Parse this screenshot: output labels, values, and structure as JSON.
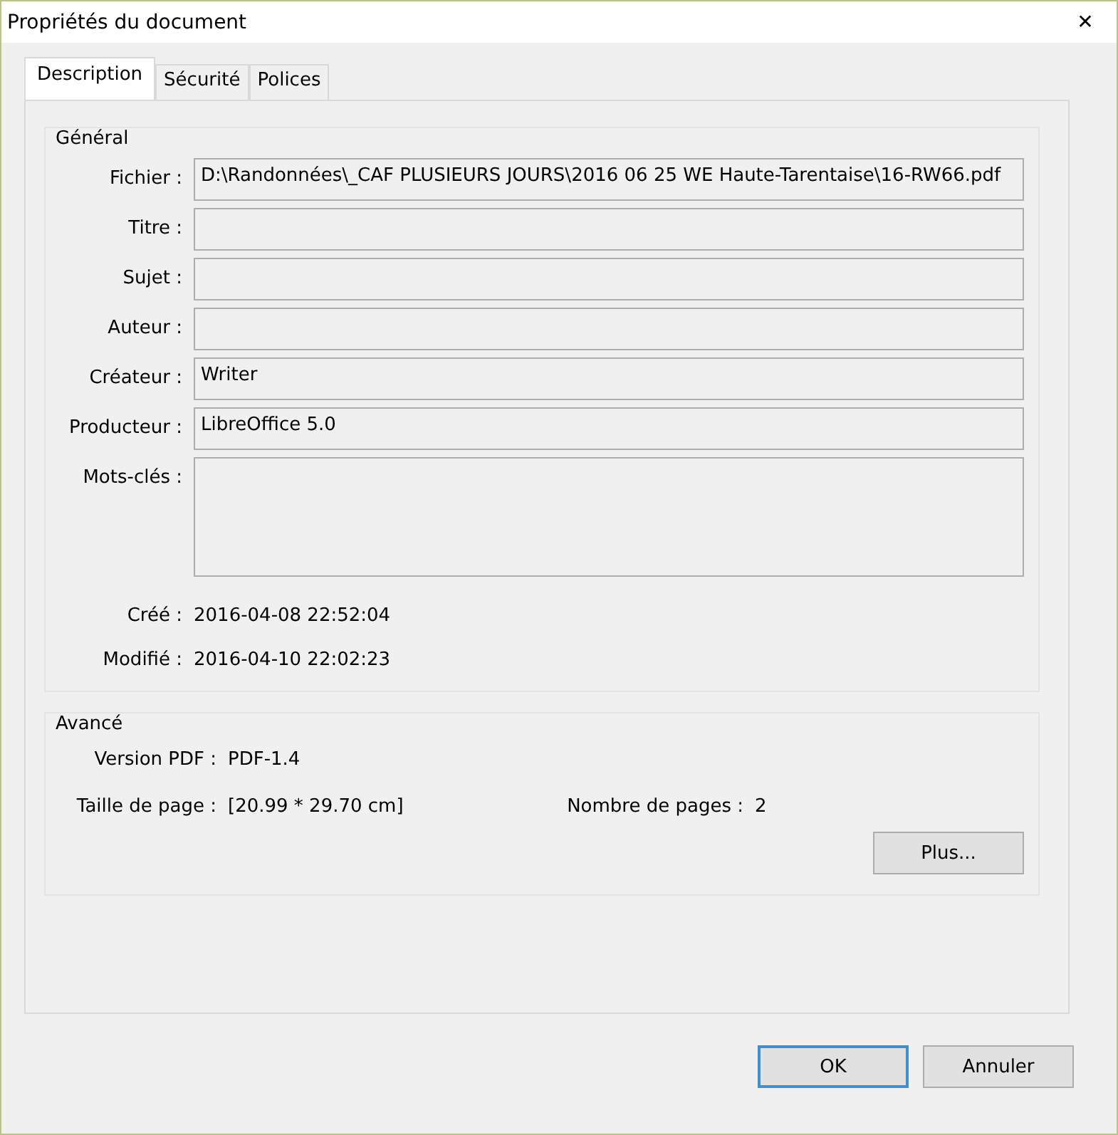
{
  "window": {
    "title": "Propriétés du document",
    "close": "✕"
  },
  "tabs": [
    {
      "label": "Description",
      "selected": true
    },
    {
      "label": "Sécurité",
      "selected": false
    },
    {
      "label": "Polices",
      "selected": false
    }
  ],
  "general": {
    "title": "Général",
    "fields": [
      {
        "label": "Fichier :",
        "value": "D:\\Randonnées\\_CAF PLUSIEURS JOURS\\2016 06 25 WE Haute-Tarentaise\\16-RW66.pdf",
        "kind": "single"
      },
      {
        "label": "Titre :",
        "kind": "single"
      },
      {
        "label": "Sujet :",
        "kind": "single"
      },
      {
        "label": "Auteur :",
        "kind": "single"
      },
      {
        "label": "Créateur :",
        "value": "Writer",
        "kind": "single"
      },
      {
        "label": "Producteur :",
        "value": "LibreOffice 5.0",
        "kind": "single"
      },
      {
        "label": "Mots-clés :",
        "kind": "multi"
      }
    ],
    "dates": [
      {
        "label": "Créé :",
        "value": "2016-04-08 22:52:04"
      },
      {
        "label": "Modifié :",
        "value": "2016-04-10 22:02:23"
      }
    ]
  },
  "advanced": {
    "title": "Avancé",
    "version_label": "Version PDF :",
    "version": "PDF-1.4",
    "size_label": "Taille de page :",
    "size": "[20.99 * 29.70 cm]",
    "pages_label": "Nombre de pages :",
    "pages": "2",
    "more_button": "Plus..."
  },
  "buttons": [
    {
      "label": "OK",
      "default": true
    },
    {
      "label": "Annuler",
      "default": false
    }
  ]
}
